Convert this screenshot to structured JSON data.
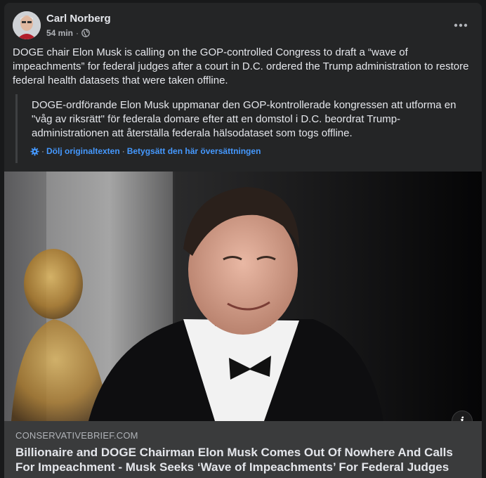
{
  "post": {
    "author": "Carl Norberg",
    "time": "54 min",
    "separator": "·",
    "text": "DOGE chair Elon Musk is calling on the GOP-controlled Congress to draft a “wave of impeachments” for federal judges after a court in D.C. ordered the Trump administration to restore federal health datasets that were taken offline.",
    "more_icon": "more-horizontal-icon",
    "privacy_icon": "globe-icon"
  },
  "translation": {
    "text": "DOGE-ordförande Elon Musk uppmanar den GOP-kontrollerade kongressen att utforma en \"våg av riksrätt\" för federala domare efter att en domstol i D.C. beordrat Trump-administrationen att återställa federala hälsodataset som togs offline.",
    "hide_original": "Dölj originaltexten",
    "rate_translation": "Betygsätt den här översättningen",
    "sep": "·",
    "icon": "gear-icon"
  },
  "link_preview": {
    "domain": "CONSERVATIVEBRIEF.COM",
    "headline": "Billionaire and DOGE Chairman Elon Musk Comes Out Of Nowhere And Calls For Impeachment - Musk Seeks ‘Wave of Impeachments’ For Federal Judges",
    "info_label": "i"
  },
  "colors": {
    "background": "#18191a",
    "card": "#242526",
    "link_box": "#3a3b3c",
    "accent_link": "#4599ff",
    "text_primary": "#e4e6eb",
    "text_secondary": "#b0b3b8"
  }
}
